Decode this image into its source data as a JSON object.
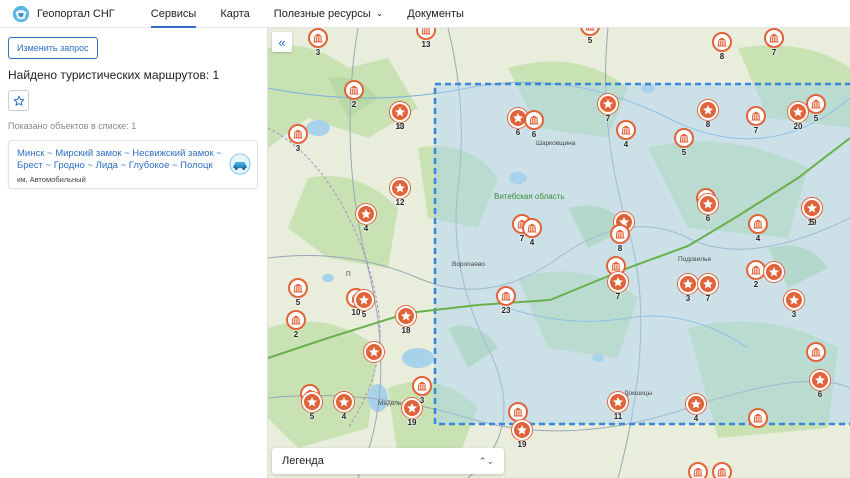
{
  "header": {
    "brand": "Геопортал СНГ",
    "nav": [
      {
        "label": "Сервисы",
        "active": true
      },
      {
        "label": "Карта",
        "active": false
      },
      {
        "label": "Полезные ресурсы",
        "active": false,
        "caret": "⌄"
      },
      {
        "label": "Документы",
        "active": false
      }
    ]
  },
  "sidebar": {
    "change_button": "Изменить запрос",
    "found_title": "Найдено туристических маршрутов: 1",
    "favorite_icon": "star-outline-icon",
    "shown_count": "Показано объектов в списке: 1",
    "route": {
      "title": "Минск ~ Мирский замок ~ Несвижский замок ~ Брест ~ Гродно ~ Лида ~ Глубокое ~ Полоцк",
      "meta": "км, Автомобильный"
    }
  },
  "map": {
    "collapse_label": "«",
    "legend_label": "Легенда",
    "legend_chevron": "⌃⌄",
    "place_labels": {
      "sharkovshchina": "Шарковщина",
      "region": "Витебская область",
      "vorotavo": "Воропаево",
      "podsvilye": "Подсвилье",
      "dokshitsy": "Докшицы",
      "miadel": "Мядель",
      "postavy": "П"
    },
    "colors": {
      "marker": "#e0633a",
      "selection": "#3a86d8",
      "road": "#6ab04c"
    },
    "markers": [
      {
        "type": "monument",
        "num": "3"
      },
      {
        "type": "monument",
        "num": "13"
      },
      {
        "type": "monument",
        "num": "5"
      },
      {
        "type": "monument",
        "num": "8"
      },
      {
        "type": "monument",
        "num": "7"
      },
      {
        "type": "monument",
        "num": "2"
      },
      {
        "type": "star",
        "num": "4"
      },
      {
        "type": "star",
        "num": "13"
      },
      {
        "type": "monument",
        "num": "3"
      },
      {
        "type": "star",
        "num": "6"
      },
      {
        "type": "monument",
        "num": "6"
      },
      {
        "type": "star",
        "num": "7"
      },
      {
        "type": "monument",
        "num": "4"
      },
      {
        "type": "monument",
        "num": "5"
      },
      {
        "type": "star",
        "num": "8"
      },
      {
        "type": "monument",
        "num": "7"
      },
      {
        "type": "star",
        "num": "20"
      },
      {
        "type": "monument",
        "num": "5"
      },
      {
        "type": "star",
        "num": "12"
      },
      {
        "type": "star",
        "num": "4"
      },
      {
        "type": "monument",
        "num": "7"
      },
      {
        "type": "monument",
        "num": "4"
      },
      {
        "type": "star",
        "num": "8"
      },
      {
        "type": "monument",
        "num": "8"
      },
      {
        "type": "monument",
        "num": "7"
      },
      {
        "type": "star",
        "num": "6"
      },
      {
        "type": "monument",
        "num": "4"
      },
      {
        "type": "star",
        "num": "19"
      },
      {
        "type": "star",
        "num": "5"
      },
      {
        "type": "monument",
        "num": "5"
      },
      {
        "type": "monument",
        "num": "10"
      },
      {
        "type": "star",
        "num": "5"
      },
      {
        "type": "star",
        "num": "18"
      },
      {
        "type": "monument",
        "num": "23"
      },
      {
        "type": "monument",
        "num": "7"
      },
      {
        "type": "star",
        "num": "7"
      },
      {
        "type": "star",
        "num": "3"
      },
      {
        "type": "star",
        "num": "7"
      },
      {
        "type": "monument",
        "num": "2"
      },
      {
        "type": "star",
        "num": "3"
      },
      {
        "type": "star",
        "num": ""
      },
      {
        "type": "monument",
        "num": "2"
      },
      {
        "type": "star",
        "num": ""
      },
      {
        "type": "monument",
        "num": ""
      },
      {
        "type": "star",
        "num": "6"
      },
      {
        "type": "monument",
        "num": "3"
      },
      {
        "type": "star",
        "num": "5"
      },
      {
        "type": "star",
        "num": "4"
      },
      {
        "type": "star",
        "num": "19"
      },
      {
        "type": "monument",
        "num": "3"
      },
      {
        "type": "monument",
        "num": "13"
      },
      {
        "type": "star",
        "num": "19"
      },
      {
        "type": "star",
        "num": "11"
      },
      {
        "type": "star",
        "num": "4"
      },
      {
        "type": "monument",
        "num": ""
      },
      {
        "type": "monument",
        "num": ""
      },
      {
        "type": "monument",
        "num": "3"
      }
    ]
  }
}
